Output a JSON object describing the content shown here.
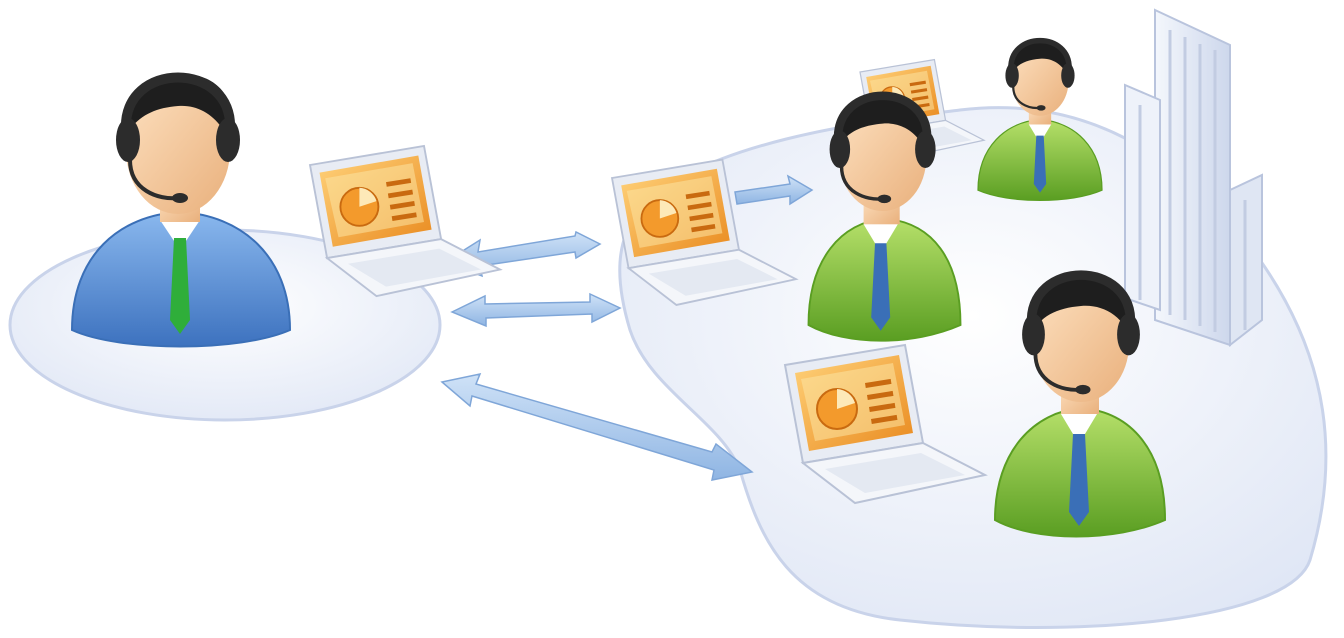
{
  "diagram": {
    "presenter": {
      "suit_color": "#5b93d6",
      "tie_color": "#2fae3a"
    },
    "attendees": [
      {
        "suit_color": "#8cc63f",
        "tie_color": "#3a6fb7"
      },
      {
        "suit_color": "#8cc63f",
        "tie_color": "#3a6fb7"
      },
      {
        "suit_color": "#8cc63f",
        "tie_color": "#3a6fb7"
      }
    ],
    "colors": {
      "platform": "#eef2fb",
      "platform_edge": "#c9d3ea",
      "arrow": "#a9c8ec",
      "screen": "#f2a23a",
      "screen_inner": "#fbe3a3",
      "laptop_body": "#f4f6fa",
      "headset": "#2c2c2c",
      "skin": "#f6cba0",
      "hair": "#1e1e1e",
      "building": "#e6ebf6"
    },
    "icons": [
      "presenter-icon",
      "attendee-icon",
      "laptop-icon",
      "bidirectional-arrow-icon",
      "office-building-icon",
      "headset-icon"
    ]
  }
}
